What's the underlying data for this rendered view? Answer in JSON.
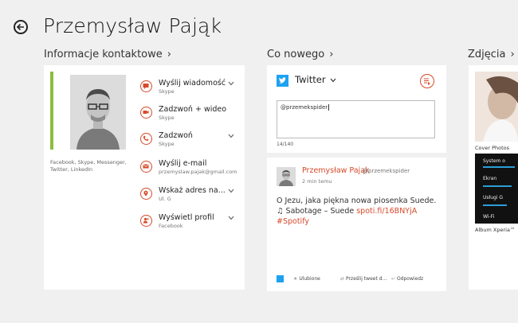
{
  "header": {
    "title": "Przemysław Pająk"
  },
  "sections": {
    "contact": "Informacje kontaktowe",
    "news": "Co nowego",
    "photos": "Zdjęcia"
  },
  "contact": {
    "services": "Facebook, Skype, Messenger, Twitter, LinkedIn",
    "actions": [
      {
        "label": "Wyślij wiadomość",
        "sub": "Skype",
        "icon": "message-icon"
      },
      {
        "label": "Zadzwoń + wideo",
        "sub": "Skype",
        "icon": "video-call-icon"
      },
      {
        "label": "Zadzwoń",
        "sub": "Skype",
        "icon": "phone-icon"
      },
      {
        "label": "Wyślij e-mail",
        "sub": "przemyslaw.pajak@gmail.com",
        "icon": "email-icon"
      },
      {
        "label": "Wskaż adres na...",
        "sub": "Ul. G",
        "icon": "map-pin-icon"
      },
      {
        "label": "Wyświetl profil",
        "sub": "Facebook",
        "icon": "profile-icon"
      }
    ]
  },
  "news": {
    "network": "Twitter",
    "compose_text": "@przemekspider",
    "counter": "14/140",
    "tweet": {
      "name": "Przemysław Pająk",
      "handle": "@przemekspider",
      "time": "2 min temu",
      "text": "O Jezu, jaka piękna nowa piosenka Suede. ♫ Sabotage – Suede ",
      "link": "spoti.fi/16BNYjA #Spotify",
      "fav": "Ulubione",
      "retweet": "Prześlij tweet d...",
      "reply": "Odpowiedz"
    }
  },
  "photos": {
    "cover_label": "Cover Photos",
    "album_label": "Album Xperia™",
    "album_rows": [
      "System o",
      "Ekran",
      "Usługi G",
      "Wi-Fi"
    ]
  },
  "colors": {
    "accent": "#d64a2a",
    "presence": "#8cbd3e",
    "twitter": "#1da1f2"
  }
}
